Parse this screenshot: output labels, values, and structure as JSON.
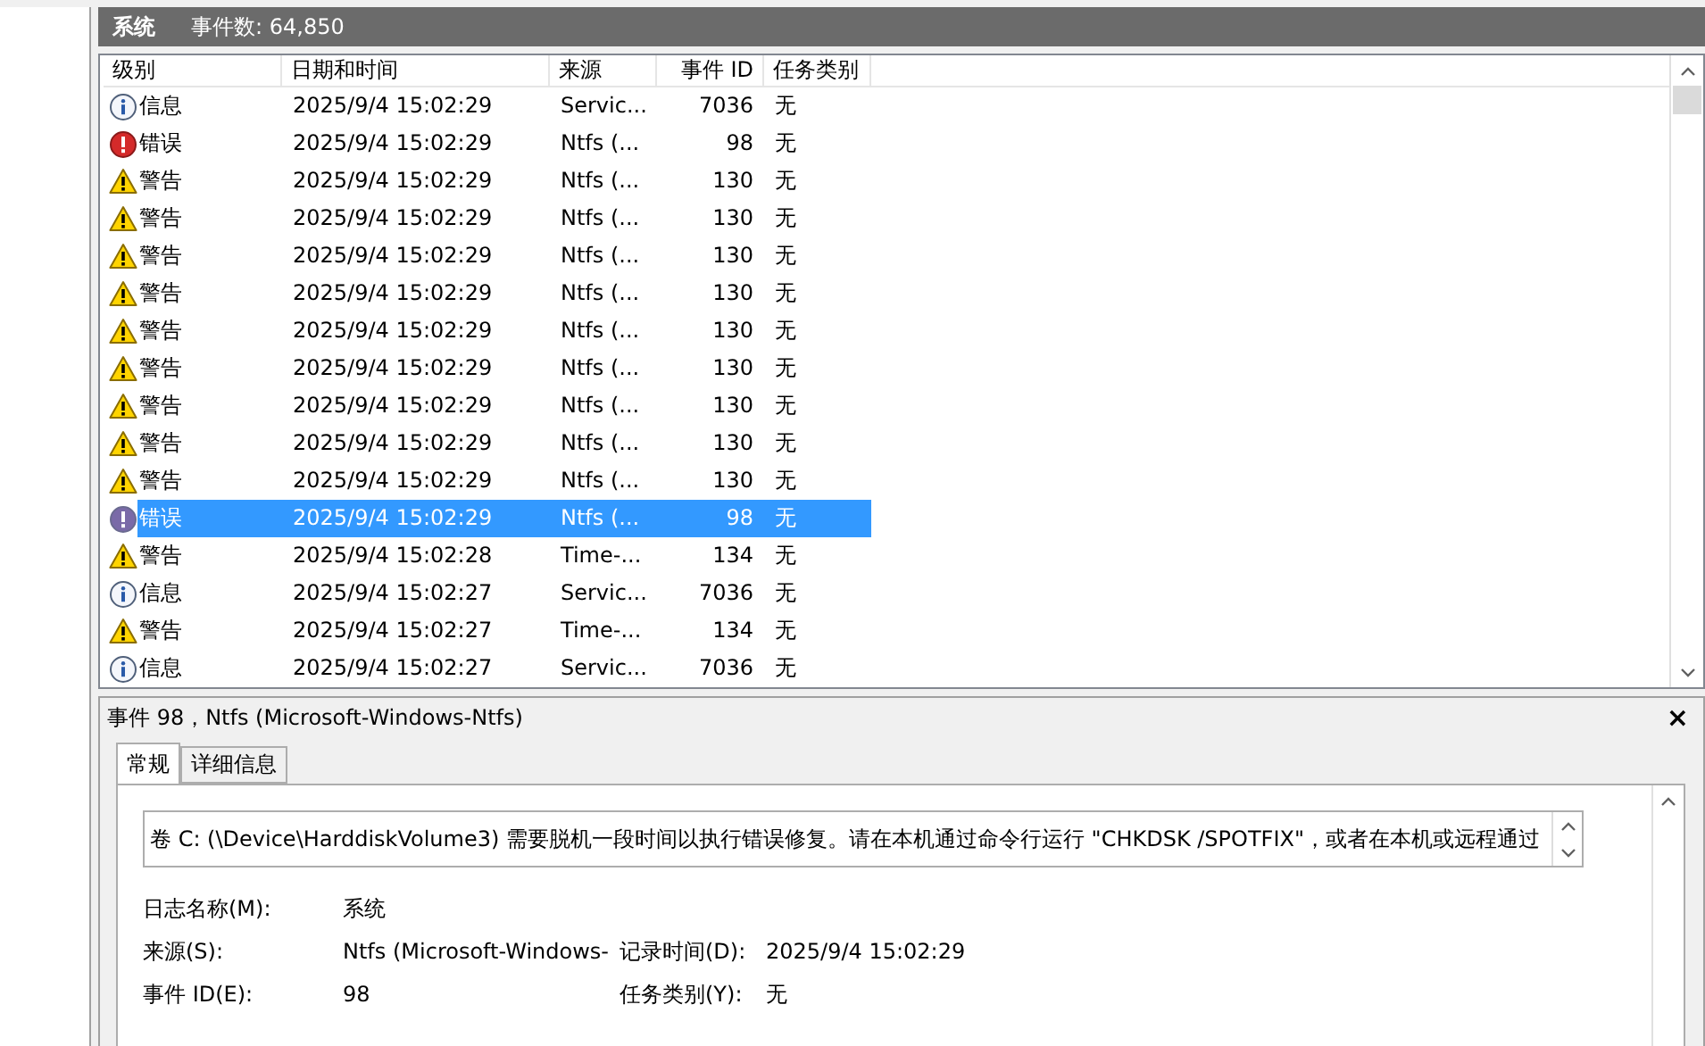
{
  "log_header": {
    "name": "系统",
    "count": "事件数: 64,850"
  },
  "table": {
    "columns": [
      "级别",
      "日期和时间",
      "来源",
      "事件 ID",
      "任务类别"
    ],
    "rows": [
      {
        "kind": "info",
        "level": "信息",
        "date": "2025/9/4 15:02:29",
        "source": "Servic...",
        "id": "7036",
        "task": "无",
        "selected": false
      },
      {
        "kind": "error",
        "level": "错误",
        "date": "2025/9/4 15:02:29",
        "source": "Ntfs (...",
        "id": "98",
        "task": "无",
        "selected": false
      },
      {
        "kind": "warning",
        "level": "警告",
        "date": "2025/9/4 15:02:29",
        "source": "Ntfs (...",
        "id": "130",
        "task": "无",
        "selected": false
      },
      {
        "kind": "warning",
        "level": "警告",
        "date": "2025/9/4 15:02:29",
        "source": "Ntfs (...",
        "id": "130",
        "task": "无",
        "selected": false
      },
      {
        "kind": "warning",
        "level": "警告",
        "date": "2025/9/4 15:02:29",
        "source": "Ntfs (...",
        "id": "130",
        "task": "无",
        "selected": false
      },
      {
        "kind": "warning",
        "level": "警告",
        "date": "2025/9/4 15:02:29",
        "source": "Ntfs (...",
        "id": "130",
        "task": "无",
        "selected": false
      },
      {
        "kind": "warning",
        "level": "警告",
        "date": "2025/9/4 15:02:29",
        "source": "Ntfs (...",
        "id": "130",
        "task": "无",
        "selected": false
      },
      {
        "kind": "warning",
        "level": "警告",
        "date": "2025/9/4 15:02:29",
        "source": "Ntfs (...",
        "id": "130",
        "task": "无",
        "selected": false
      },
      {
        "kind": "warning",
        "level": "警告",
        "date": "2025/9/4 15:02:29",
        "source": "Ntfs (...",
        "id": "130",
        "task": "无",
        "selected": false
      },
      {
        "kind": "warning",
        "level": "警告",
        "date": "2025/9/4 15:02:29",
        "source": "Ntfs (...",
        "id": "130",
        "task": "无",
        "selected": false
      },
      {
        "kind": "warning",
        "level": "警告",
        "date": "2025/9/4 15:02:29",
        "source": "Ntfs (...",
        "id": "130",
        "task": "无",
        "selected": false
      },
      {
        "kind": "error",
        "level": "错误",
        "date": "2025/9/4 15:02:29",
        "source": "Ntfs (...",
        "id": "98",
        "task": "无",
        "selected": true
      },
      {
        "kind": "warning",
        "level": "警告",
        "date": "2025/9/4 15:02:28",
        "source": "Time-...",
        "id": "134",
        "task": "无",
        "selected": false
      },
      {
        "kind": "info",
        "level": "信息",
        "date": "2025/9/4 15:02:27",
        "source": "Servic...",
        "id": "7036",
        "task": "无",
        "selected": false
      },
      {
        "kind": "warning",
        "level": "警告",
        "date": "2025/9/4 15:02:27",
        "source": "Time-...",
        "id": "134",
        "task": "无",
        "selected": false
      },
      {
        "kind": "info",
        "level": "信息",
        "date": "2025/9/4 15:02:27",
        "source": "Servic...",
        "id": "7036",
        "task": "无",
        "selected": false
      }
    ]
  },
  "detail": {
    "title": "事件 98，Ntfs (Microsoft-Windows-Ntfs)",
    "close": "×",
    "tabs": [
      {
        "label": "常规",
        "selected": true
      },
      {
        "label": "详细信息",
        "selected": false
      }
    ],
    "message": "卷 C: (\\Device\\HarddiskVolume3) 需要脱机一段时间以执行错误修复。请在本机通过命令行运行 \"CHKDSK /SPOTFIX\"，或者在本机或远程通过",
    "fields": [
      [
        {
          "label": "日志名称(M):",
          "value": "系统"
        }
      ],
      [
        {
          "label": "来源(S):",
          "value": "Ntfs (Microsoft-Windows-"
        },
        {
          "label": "记录时间(D):",
          "value": "2025/9/4 15:02:29"
        }
      ],
      [
        {
          "label": "事件 ID(E):",
          "value": "98"
        },
        {
          "label": "任务类别(Y):",
          "value": "无"
        }
      ]
    ]
  }
}
